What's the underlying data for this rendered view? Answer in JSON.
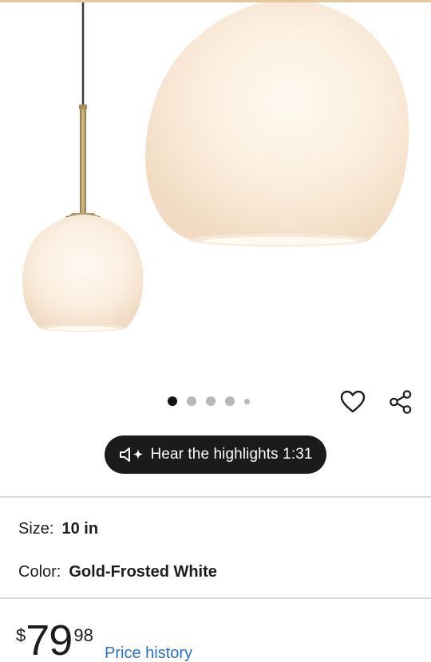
{
  "gallery": {
    "image_name": "Gold-Frosted White pendant light",
    "dot_count": 5,
    "active_index": 0
  },
  "actions": {
    "favorite_icon": "heart-icon",
    "share_icon": "share-icon"
  },
  "highlights": {
    "label": "Hear the highlights 1:31",
    "icon": "speaker-sparkle-icon"
  },
  "specs": {
    "size_label": "Size:",
    "size_value": "10 in",
    "color_label": "Color:",
    "color_value": "Gold-Frosted White"
  },
  "price": {
    "currency": "$",
    "whole": "79",
    "cents": "98",
    "history_label": "Price history"
  },
  "colors": {
    "accent_link": "#2a6fc9",
    "pill_bg": "#1b1b1b",
    "top_strip": "#e4c79a"
  }
}
